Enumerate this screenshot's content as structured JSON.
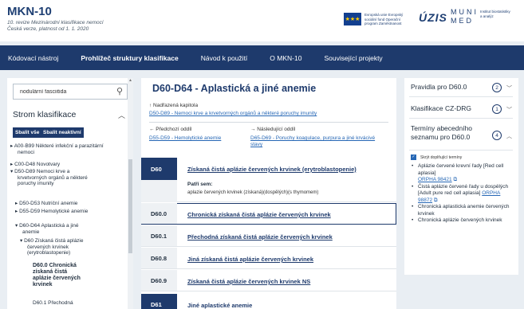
{
  "header": {
    "title": "MKN-10",
    "subtitle_1": "10. revize Mezinárodní klasifikace nemocí",
    "subtitle_2": "Česká verze, platnost od 1. 1. 2020",
    "eu_text": "Evropská unie Evropský sociální fond Operační program Zaměstnanost",
    "uzis": "ÚZIS",
    "muni": "MUNI MED",
    "muni_sub": "Institut biostatistiky a analýz"
  },
  "nav": {
    "items": [
      "Kódovací nástroj",
      "Prohlížeč struktury klasifikace",
      "Návod k použití",
      "O MKN-10",
      "Související projekty"
    ]
  },
  "left": {
    "search_value": "nodulární fasciitida",
    "heading": "Strom klasifikace",
    "btn_collapse": "Sbalit vše",
    "btn_inactive": "Sbalit neaktivní",
    "tree": [
      "▸ A00-B99 Některé infekční a parazitární nemoci",
      "▸ C00-D48 Novotvary",
      "▾ D50-D89 Nemoci krve a krvetvorných orgánů a některé poruchy imunity",
      "▸ D50-D53 Nutriční anemie",
      "▸ D55-D59 Hemolytické anemie",
      "▾ D60-D64 Aplastická a jiné anemie",
      "▾ D60 Získaná čistá aplázie červených krvinek (erytroblastopenie)",
      "D60.0 Chronická získaná čistá aplázie červených krvinek",
      "D60.1 Přechodná"
    ]
  },
  "center": {
    "title": "D60-D64 - Aplastická a jiné anemie",
    "parent_label": "↑ Nadřazená kapitola",
    "parent_link": "D50-D89 - Nemoci krve a krvetvorných orgánů a některé poruchy imunity",
    "prev_label": "← Předchozí oddíl",
    "prev_link": "D55-D59 - Hemolytické anemie",
    "next_label": "→ Následující oddíl",
    "next_link": "D65-D69 - Poruchy koagulace, purpura a jiné krvácivé stavy",
    "rows": [
      {
        "code": "D60",
        "name": "Získaná čistá aplázie červených krvinek (erytroblastopenie)"
      },
      {
        "code": "D60.0",
        "name": "Chronická získaná čistá aplázie červených krvinek"
      },
      {
        "code": "D60.1",
        "name": "Přechodná získaná čistá aplázie červených krvinek"
      },
      {
        "code": "D60.8",
        "name": "Jiná získaná čistá aplázie červených krvinek"
      },
      {
        "code": "D60.9",
        "name": "Získaná čistá aplázie červených krvinek NS"
      },
      {
        "code": "D61",
        "name": "Jiné aplastické anemie"
      }
    ],
    "includes_label": "Patří sem:",
    "includes_text": "aplazie červených krvinek (získaná)(dospělých)(s thymomem)"
  },
  "right": {
    "s1": "Pravidla pro D60.0",
    "s1_badge": "2",
    "s2": "Klasifikace CZ-DRG",
    "s2_badge": "1",
    "s3": "Termíny abecedního seznamu pro D60.0",
    "s3_badge": "4",
    "checkbox_label": "Skrýt doplňující termíny",
    "terms": [
      {
        "text": "Aplázie červené krevní řady [Red cell aplasia]",
        "link": "ORPHA 98421"
      },
      {
        "text": "Čistá aplázie červené řady u dospělých [Adult pure red cell aplasia]",
        "link": "ORPHA 98872"
      },
      {
        "text": "Chronická aplastická anemie červených krvinek",
        "link": ""
      },
      {
        "text": "Chronická aplázie červených krvinek",
        "link": ""
      }
    ]
  }
}
